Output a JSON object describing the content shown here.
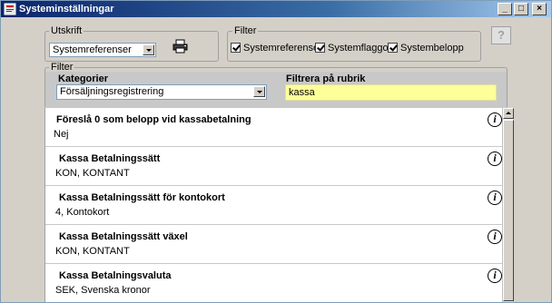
{
  "window": {
    "title": "Systeminställningar",
    "minimize": "_",
    "maximize": "□",
    "close": "×"
  },
  "utskrift": {
    "label": "Utskrift",
    "selected": "Systemreferenser",
    "print_icon": "printer-icon"
  },
  "filter_top": {
    "label": "Filter",
    "checkboxes": [
      {
        "label": "Systemreferenser",
        "checked": true
      },
      {
        "label": "Systemflaggor",
        "checked": true
      },
      {
        "label": "Systembelopp",
        "checked": true
      }
    ]
  },
  "help_icon": "help-icon",
  "filter": {
    "label": "Filter",
    "kategorier_label": "Kategorier",
    "kategori_selected": "Försäljningsregistrering",
    "rubrik_label": "Filtrera på rubrik",
    "rubrik_value": "kassa"
  },
  "settings": [
    {
      "title": "Föreslå 0 som belopp vid kassabetalning",
      "value": "Nej"
    },
    {
      "title": "Kassa Betalningssätt",
      "value": "KON, KONTANT"
    },
    {
      "title": "Kassa Betalningssätt för kontokort",
      "value": "4, Kontokort"
    },
    {
      "title": "Kassa Betalningssätt växel",
      "value": "KON, KONTANT"
    },
    {
      "title": "Kassa Betalningsvaluta",
      "value": "SEK, Svenska kronor"
    }
  ],
  "info_glyph": "i",
  "colors": {
    "titlebar": "#0a246a",
    "filter_input_bg": "#ffff99"
  }
}
